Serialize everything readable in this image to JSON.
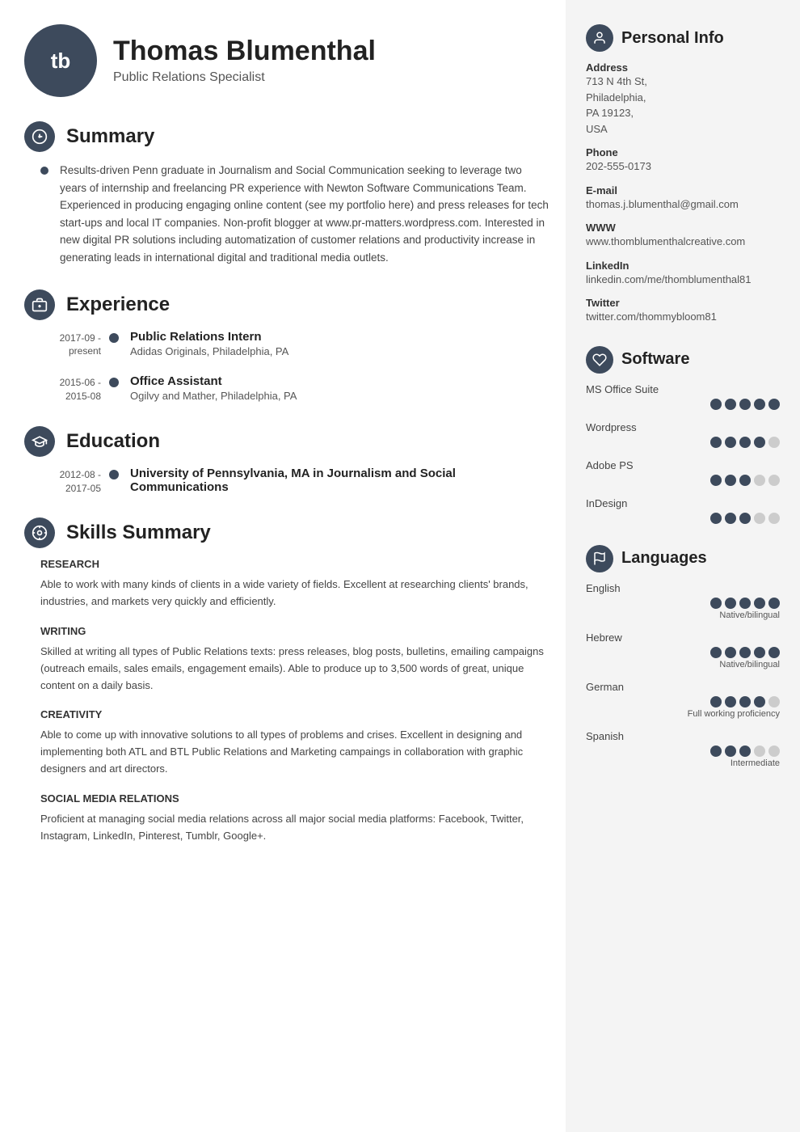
{
  "header": {
    "initials": "tb",
    "name": "Thomas Blumenthal",
    "subtitle": "Public Relations Specialist"
  },
  "summary": {
    "title": "Summary",
    "icon": "⊕",
    "text": "Results-driven Penn graduate in Journalism and Social Communication seeking to leverage two years of internship and freelancing PR experience with Newton Software Communications Team. Experienced in producing engaging online content (see my portfolio here) and press releases for tech start-ups and local IT companies. Non-profit blogger at www.pr-matters.wordpress.com. Interested in new digital PR solutions including automatization of customer relations and productivity increase in generating leads in international digital and traditional media outlets."
  },
  "experience": {
    "title": "Experience",
    "icon": "💼",
    "items": [
      {
        "date": "2017-09 -\npresent",
        "title": "Public Relations Intern",
        "company": "Adidas Originals, Philadelphia, PA"
      },
      {
        "date": "2015-06 -\n2015-08",
        "title": "Office Assistant",
        "company": "Ogilvy and Mather, Philadelphia, PA"
      }
    ]
  },
  "education": {
    "title": "Education",
    "icon": "🎓",
    "items": [
      {
        "date": "2012-08 -\n2017-05",
        "title": "University of Pennsylvania, MA in Journalism and Social Communications",
        "company": ""
      }
    ]
  },
  "skills": {
    "title": "Skills Summary",
    "icon": "🎯",
    "categories": [
      {
        "name": "RESEARCH",
        "text": "Able to work with many kinds of clients in a wide variety of fields. Excellent at researching clients' brands, industries, and markets very quickly and efficiently."
      },
      {
        "name": "WRITING",
        "text": "Skilled at writing all types of Public Relations texts: press releases, blog posts, bulletins, emailing campaigns (outreach emails, sales emails, engagement emails). Able to produce up to 3,500 words of great, unique content on a daily basis."
      },
      {
        "name": "CREATIVITY",
        "text": "Able to come up with innovative solutions to all types of problems and crises. Excellent in designing and implementing both ATL and BTL Public Relations and Marketing campaings in collaboration with graphic designers and art directors."
      },
      {
        "name": "SOCIAL MEDIA RELATIONS",
        "text": "Proficient at managing social media relations across all major social media platforms: Facebook, Twitter, Instagram, LinkedIn, Pinterest, Tumblr, Google+."
      }
    ]
  },
  "personal_info": {
    "title": "Personal Info",
    "icon": "👤",
    "fields": [
      {
        "label": "Address",
        "value": "713 N 4th St,\nPhiladelphia,\nPA 19123,\nUSA"
      },
      {
        "label": "Phone",
        "value": "202-555-0173"
      },
      {
        "label": "E-mail",
        "value": "thomas.j.blumenthal@gmail.com"
      },
      {
        "label": "WWW",
        "value": "www.thomblumenthalcreative.com"
      },
      {
        "label": "LinkedIn",
        "value": "linkedin.com/me/thomblumenthal81"
      },
      {
        "label": "Twitter",
        "value": "twitter.com/thommybloom81"
      }
    ]
  },
  "software": {
    "title": "Software",
    "icon": "💾",
    "items": [
      {
        "name": "MS Office Suite",
        "filled": 5,
        "total": 5
      },
      {
        "name": "Wordpress",
        "filled": 4,
        "total": 5
      },
      {
        "name": "Adobe PS",
        "filled": 3,
        "total": 5
      },
      {
        "name": "InDesign",
        "filled": 3,
        "total": 5
      }
    ]
  },
  "languages": {
    "title": "Languages",
    "icon": "🚩",
    "items": [
      {
        "name": "English",
        "filled": 5,
        "total": 5,
        "level": "Native/bilingual"
      },
      {
        "name": "Hebrew",
        "filled": 5,
        "total": 5,
        "level": "Native/bilingual"
      },
      {
        "name": "German",
        "filled": 4,
        "total": 5,
        "level": "Full working proficiency"
      },
      {
        "name": "Spanish",
        "filled": 3,
        "total": 5,
        "level": "Intermediate"
      }
    ]
  }
}
